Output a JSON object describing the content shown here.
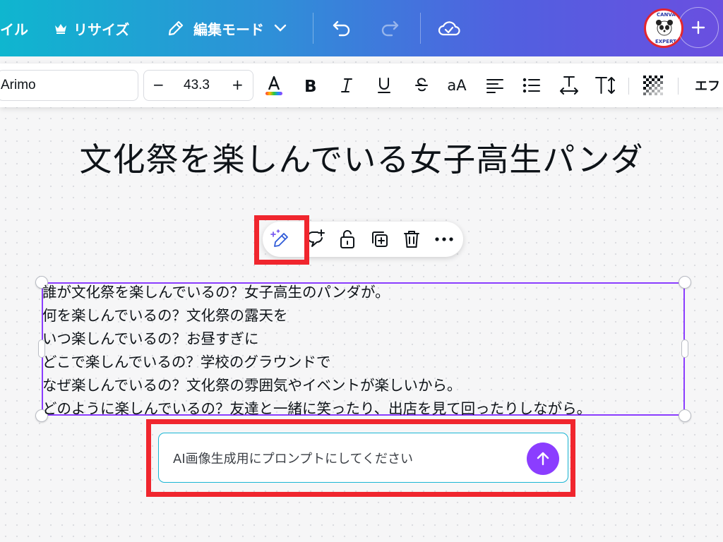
{
  "topbar": {
    "file_label": "イル",
    "resize_label": "リサイズ",
    "edit_mode_label": "編集モード",
    "avatar_top_text": "CANVA",
    "avatar_bottom_text": "EXPERT"
  },
  "text_toolbar": {
    "font_name": "Arimo",
    "font_size": "43.3",
    "minus_label": "−",
    "plus_label": "+",
    "case_label": "aA",
    "effects_label": "エフ"
  },
  "canvas": {
    "title": "文化祭を楽しんでいる女子高生パンダ",
    "body_lines": [
      "誰が文化祭を楽しんでいるの？女子高生のパンダが。",
      "何を楽しんでいるの？文化祭の露天を",
      "いつ楽しんでいるの？お昼すぎに",
      "どこで楽しんでいるの？学校のグラウンドで",
      "なぜ楽しんでいるの？文化祭の雰囲気やイベントが楽しいから。",
      "どのように楽しんでいるの？友達と一緒に笑ったり、出店を見て回ったりしながら。"
    ]
  },
  "prompt": {
    "text": "AI画像生成用にプロンプトにしてください"
  },
  "colors": {
    "accent_purple": "#8b3dff",
    "highlight_red": "#f0262e",
    "gradient_start": "#0fb6cf",
    "gradient_end": "#6a4fe0"
  }
}
